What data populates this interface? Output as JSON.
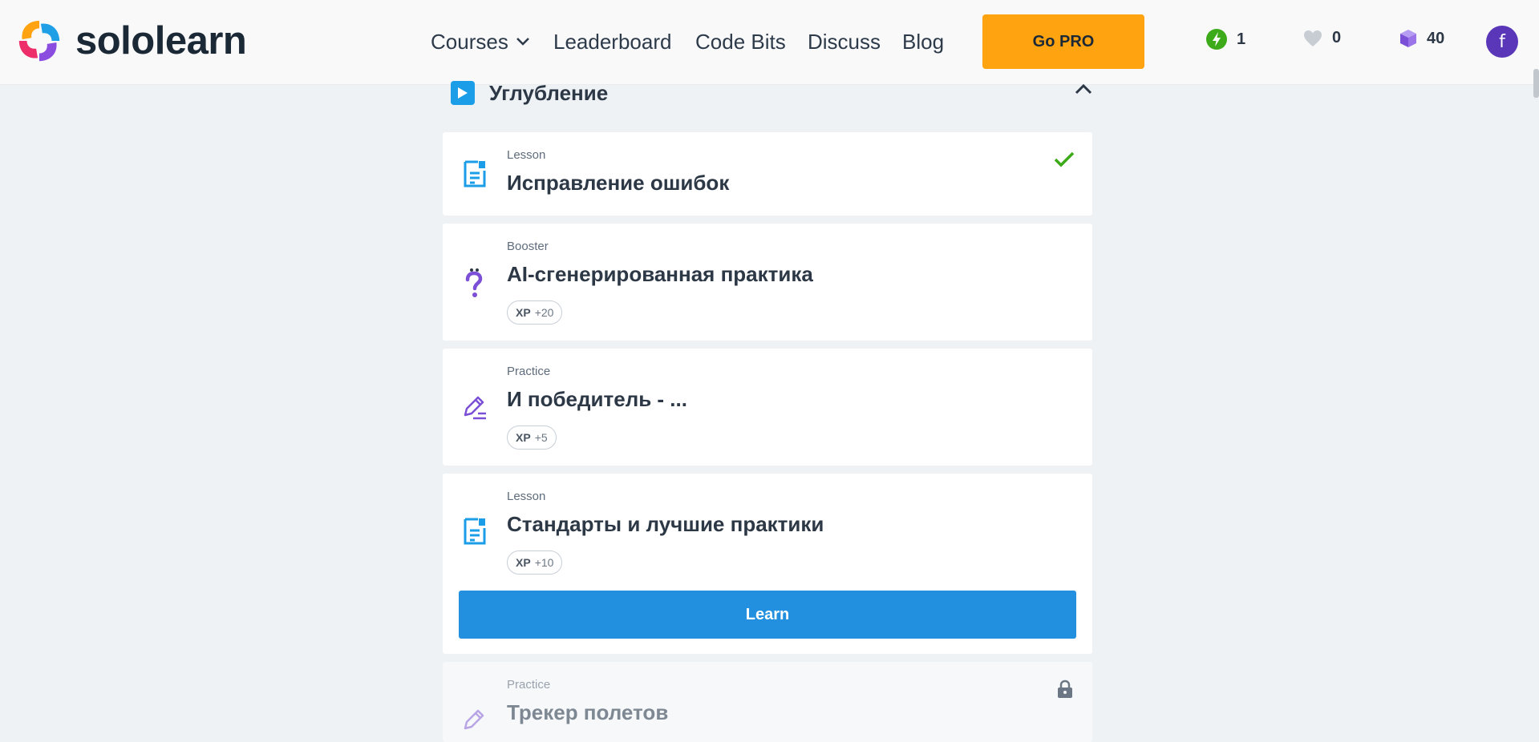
{
  "header": {
    "brand": "sololearn",
    "nav": {
      "courses": "Courses",
      "leaderboard": "Leaderboard",
      "code_bits": "Code Bits",
      "discuss": "Discuss",
      "blog": "Blog"
    },
    "go_pro": "Go PRO",
    "stats": {
      "streak": "1",
      "hearts": "0",
      "gems": "40"
    },
    "avatar_letter": "f"
  },
  "section": {
    "title": "Углубление",
    "icon": "play-icon",
    "collapse_icon": "chevron-up-icon"
  },
  "items": [
    {
      "type": "Lesson",
      "title": "Исправление ошибок",
      "icon": "lesson-icon",
      "status": "completed"
    },
    {
      "type": "Booster",
      "title": "AI-сгенерированная практика",
      "icon": "question-icon",
      "xp_label": "XP",
      "xp_value": "+20"
    },
    {
      "type": "Practice",
      "title": "И победитель - ...",
      "icon": "pencil-icon",
      "xp_label": "XP",
      "xp_value": "+5"
    },
    {
      "type": "Lesson",
      "title": "Стандарты и лучшие практики",
      "icon": "lesson-icon",
      "xp_label": "XP",
      "xp_value": "+10",
      "action": "Learn"
    },
    {
      "type": "Practice",
      "title": "Трекер полетов",
      "icon": "pencil-icon",
      "status": "locked"
    }
  ],
  "colors": {
    "accent_blue": "#2290df",
    "pro_orange": "#ffa310",
    "check_green": "#3dab19",
    "booster_purple": "#7b4fd6"
  }
}
